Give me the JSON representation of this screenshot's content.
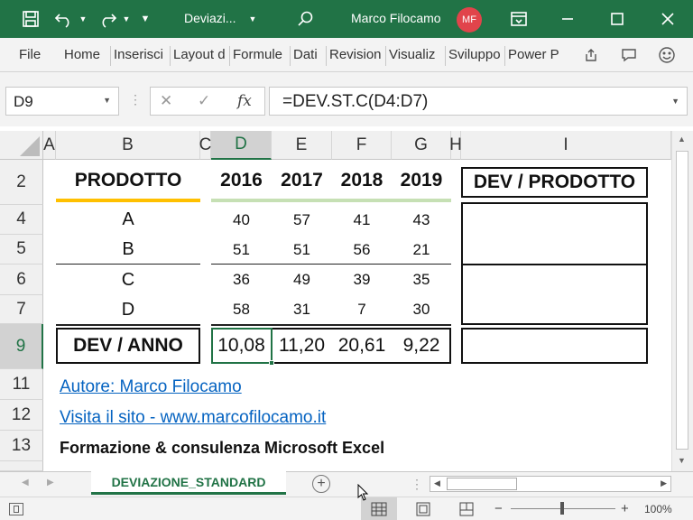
{
  "window": {
    "doc_title": "Deviazi...",
    "user_name": "Marco Filocamo",
    "user_initials": "MF"
  },
  "ribbon": {
    "tabs": [
      "File",
      "Home",
      "Inserisci",
      "Layout d",
      "Formule",
      "Dati",
      "Revision",
      "Visualiz",
      "Sviluppo",
      "Power P"
    ]
  },
  "formula_bar": {
    "name_box": "D9",
    "formula": "=DEV.ST.C(D4:D7)"
  },
  "columns": [
    "A",
    "B",
    "C",
    "D",
    "E",
    "F",
    "G",
    "H",
    "I"
  ],
  "rows": [
    "2",
    "4",
    "5",
    "6",
    "7",
    "9",
    "11",
    "12",
    "13"
  ],
  "table": {
    "header_product": "PRODOTTO",
    "years": [
      "2016",
      "2017",
      "2018",
      "2019"
    ],
    "header_dev_product": "DEV / PRODOTTO",
    "products": [
      {
        "name": "A",
        "values": [
          "40",
          "57",
          "41",
          "43"
        ]
      },
      {
        "name": "B",
        "values": [
          "51",
          "51",
          "56",
          "21"
        ]
      },
      {
        "name": "C",
        "values": [
          "36",
          "49",
          "39",
          "35"
        ]
      },
      {
        "name": "D",
        "values": [
          "58",
          "31",
          "7",
          "30"
        ]
      }
    ],
    "dev_label": "DEV / ANNO",
    "dev_values": [
      "10,08",
      "11,20",
      "20,61",
      "9,22"
    ]
  },
  "footer": {
    "author_link": "Autore: Marco Filocamo",
    "site_link": "Visita il sito - www.marcofilocamo.it",
    "tagline": "Formazione & consulenza Microsoft Excel"
  },
  "sheet_tab": "DEVIAZIONE_STANDARD",
  "status": {
    "zoom": "100%"
  },
  "colors": {
    "accent": "#217346",
    "avatar": "#e1444b",
    "link": "#0563c1",
    "underline_orange": "#ffc000",
    "underline_green": "#c6e0b4"
  }
}
